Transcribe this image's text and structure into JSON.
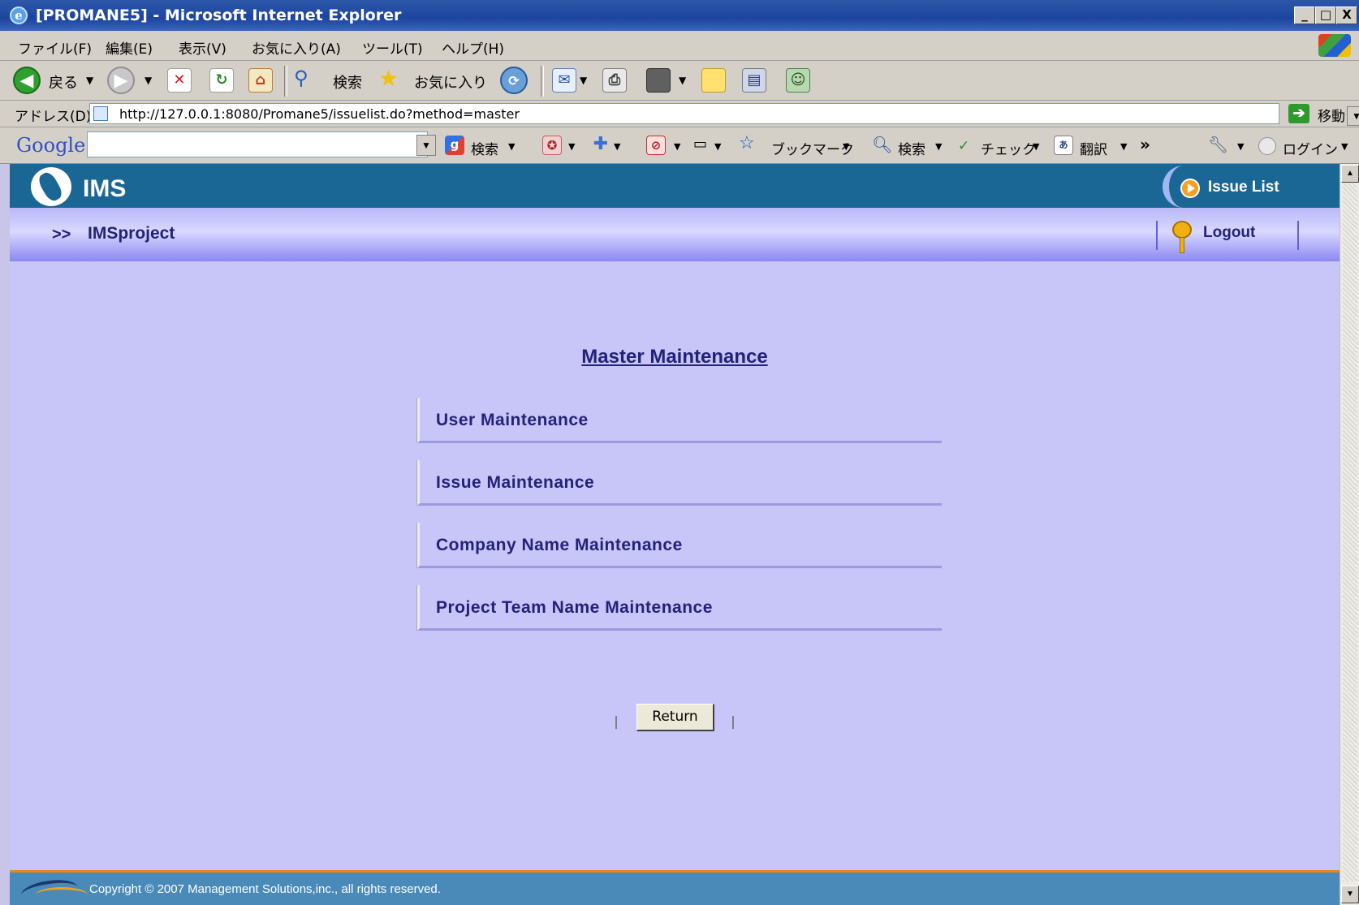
{
  "window": {
    "title": "[PROMANE5] - Microsoft Internet Explorer",
    "buttons": {
      "minimize": "_",
      "maximize": "□",
      "close": "X"
    }
  },
  "menubar": [
    "ファイル(F)",
    "編集(E)",
    "表示(V)",
    "お気に入り(A)",
    "ツール(T)",
    "ヘルプ(H)"
  ],
  "toolbar": {
    "back_label": "戻る",
    "search_label": "検索",
    "favorites_label": "お気に入り"
  },
  "addressbar": {
    "label": "アドレス(D)",
    "url": "http://127.0.0.1:8080/Promane5/issuelist.do?method=master",
    "go_label": "移動"
  },
  "googlebar": {
    "logo": "Google",
    "search_label": "検索",
    "bookmarks_label": "ブックマーク",
    "search2_label": "検索",
    "check_label": "チェック",
    "translate_label": "翻訳",
    "more": "»",
    "login_label": "ログイン"
  },
  "header": {
    "app_name": "IMS",
    "issue_list_label": "Issue List",
    "breadcrumb_arrows": ">>",
    "project_name": "IMSproject",
    "logout_label": "Logout"
  },
  "main": {
    "title": "Master Maintenance",
    "items": [
      {
        "label": "User Maintenance"
      },
      {
        "label": "Issue Maintenance"
      },
      {
        "label": "Company Name Maintenance"
      },
      {
        "label": "Project Team Name Maintenance"
      }
    ],
    "return_label": "Return"
  },
  "footer": {
    "copyright": "Copyright © 2007  Management Solutions,inc., all rights reserved."
  },
  "colors": {
    "header_blue": "#1a6796",
    "page_bg": "#c8c5f8",
    "link_navy": "#22227a",
    "footer_blue": "#4a8ab8",
    "footer_accent": "#e08a20"
  }
}
